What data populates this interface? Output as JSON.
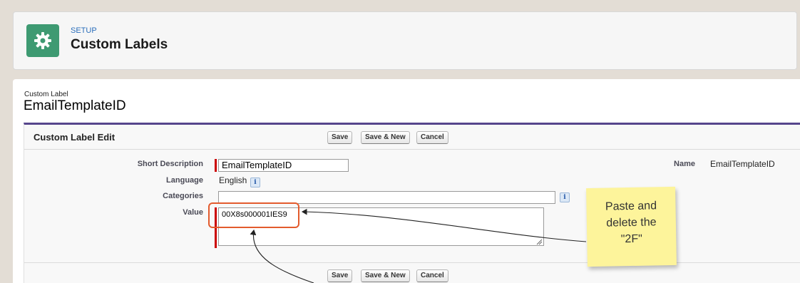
{
  "header": {
    "breadcrumb": "SETUP",
    "title": "Custom Labels",
    "icon": "gear-icon",
    "icon_color": "#3e9a72"
  },
  "record": {
    "type_label": "Custom Label",
    "name": "EmailTemplateID"
  },
  "edit": {
    "section_title": "Custom Label Edit",
    "buttons": {
      "save": "Save",
      "save_new": "Save & New",
      "cancel": "Cancel"
    },
    "fields": {
      "short_description": {
        "label": "Short Description",
        "value": "EmailTemplateID"
      },
      "language": {
        "label": "Language",
        "value": "English"
      },
      "categories": {
        "label": "Categories",
        "value": ""
      },
      "value": {
        "label": "Value",
        "value": "00X8s000001IES9"
      },
      "name": {
        "label": "Name",
        "value": "EmailTemplateID"
      }
    },
    "info_icon": "i"
  },
  "annotation": {
    "note_lines": [
      "Paste and",
      "delete the",
      "\"2F\""
    ],
    "note_color": "#fdf49b",
    "highlight_color": "#e35b2d"
  }
}
